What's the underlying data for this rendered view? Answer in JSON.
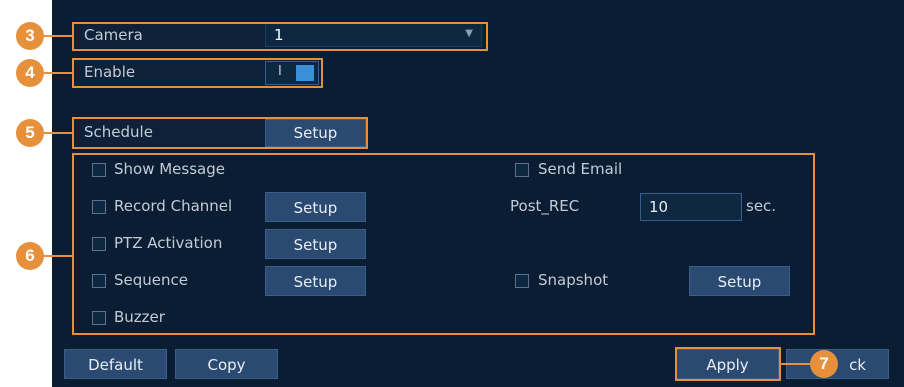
{
  "camera": {
    "label": "Camera",
    "value": "1"
  },
  "enable": {
    "label": "Enable",
    "toggle_text": "I",
    "state": "on"
  },
  "schedule": {
    "label": "Schedule",
    "button": "Setup"
  },
  "actions": {
    "show_message": "Show Message",
    "send_email": "Send Email",
    "record_channel": "Record Channel",
    "record_channel_button": "Setup",
    "post_rec_label": "Post_REC",
    "post_rec_value": "10",
    "post_rec_unit": "sec.",
    "ptz_activation": "PTZ Activation",
    "ptz_button": "Setup",
    "sequence": "Sequence",
    "sequence_button": "Setup",
    "snapshot": "Snapshot",
    "snapshot_button": "Setup",
    "buzzer": "Buzzer"
  },
  "footer": {
    "default": "Default",
    "copy": "Copy",
    "apply": "Apply",
    "back_visible": "ck"
  },
  "markers": [
    "3",
    "4",
    "5",
    "6",
    "7"
  ],
  "colors": {
    "accent": "#e6903c",
    "panel": "#0b1d33",
    "button": "#2b4a72"
  }
}
